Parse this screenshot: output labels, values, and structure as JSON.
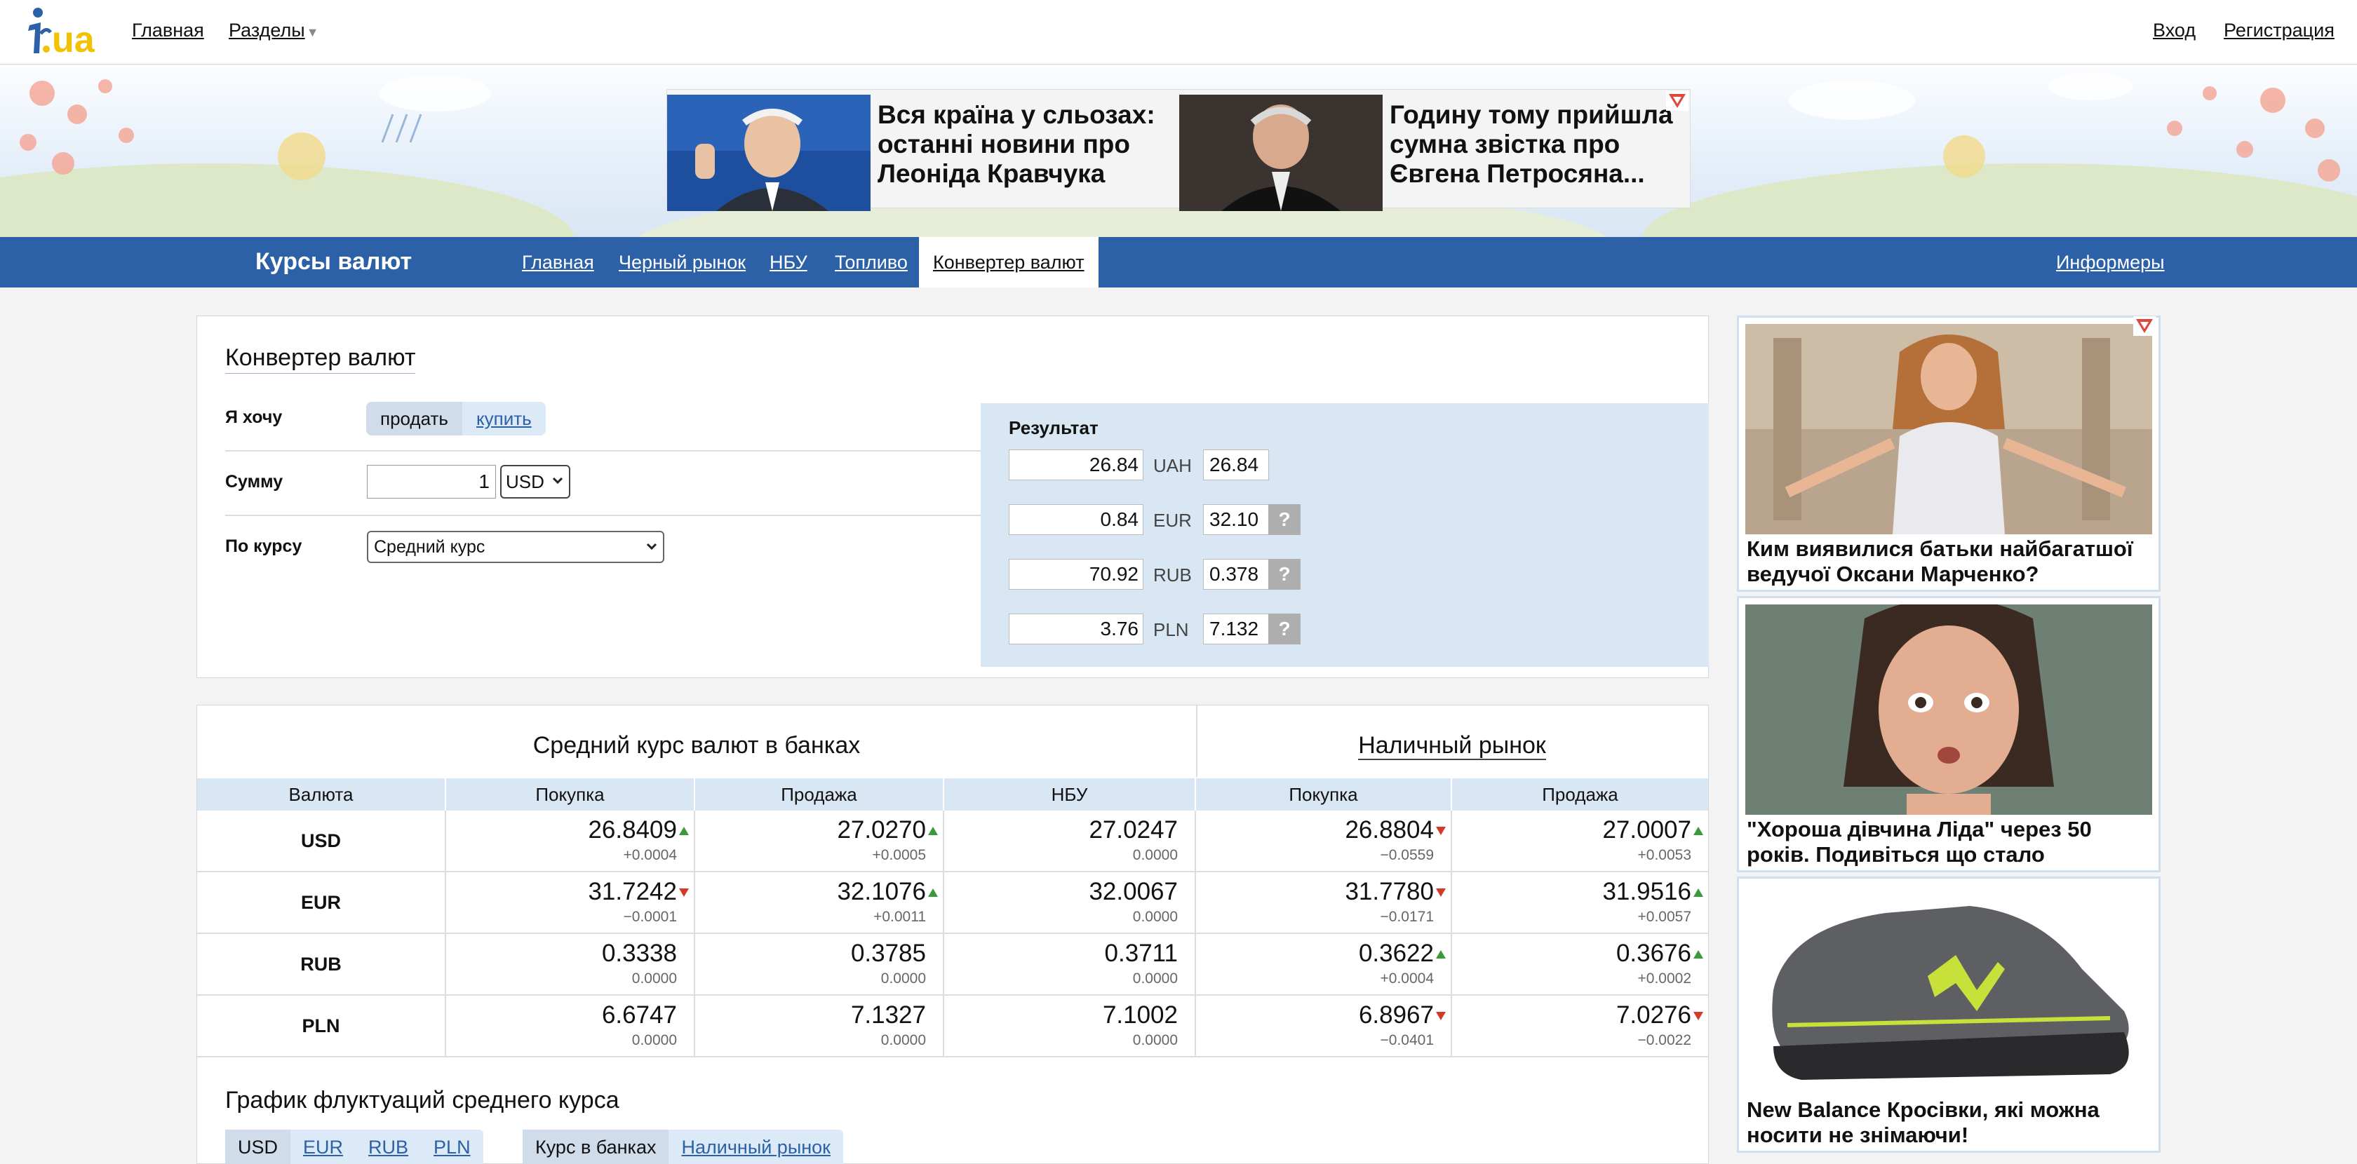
{
  "header": {
    "logo_text": "i.ua",
    "nav_home": "Главная",
    "nav_sections": "Разделы",
    "login": "Вход",
    "register": "Регистрация"
  },
  "promo": {
    "items": [
      {
        "text": "Вся країна у сльозах: останні новини про Леоніда Кравчука"
      },
      {
        "text": "Годину тому прийшла сумна звістка про Євгена Петросяна..."
      }
    ]
  },
  "subnav": {
    "title": "Курсы валют",
    "items": [
      "Главная",
      "Черный рынок",
      "НБУ",
      "Топливо",
      "Конвертер валют"
    ],
    "active": "Конвертер валют",
    "informers": "Информеры"
  },
  "converter": {
    "title": "Конвертер валют",
    "want_label": "Я хочу",
    "sell": "продать",
    "buy": "купить",
    "sum_label": "Сумму",
    "amount": "1",
    "currency": "USD",
    "rate_label": "По курсу",
    "rate_option": "Средний курс",
    "result_title": "Результат",
    "results": [
      {
        "value": "26.84",
        "code": "UAH",
        "rate": "26.84"
      },
      {
        "value": "0.84",
        "code": "EUR",
        "rate": "32.10",
        "help": "?"
      },
      {
        "value": "70.92",
        "code": "RUB",
        "rate": "0.378",
        "help": "?"
      },
      {
        "value": "3.76",
        "code": "PLN",
        "rate": "7.132",
        "help": "?"
      }
    ]
  },
  "rates": {
    "avg_title": "Средний курс валют в банках",
    "cash_title": "Наличный рынок",
    "headers": [
      "Валюта",
      "Покупка",
      "Продажа",
      "НБУ",
      "Покупка",
      "Продажа"
    ],
    "rows": [
      {
        "cur": "USD",
        "cells": [
          {
            "v": "26.8409",
            "d": "+0.0004",
            "t": "up"
          },
          {
            "v": "27.0270",
            "d": "+0.0005",
            "t": "up"
          },
          {
            "v": "27.0247",
            "d": "0.0000",
            "t": ""
          },
          {
            "v": "26.8804",
            "d": "−0.0559",
            "t": "down"
          },
          {
            "v": "27.0007",
            "d": "+0.0053",
            "t": "up"
          }
        ]
      },
      {
        "cur": "EUR",
        "cells": [
          {
            "v": "31.7242",
            "d": "−0.0001",
            "t": "down"
          },
          {
            "v": "32.1076",
            "d": "+0.0011",
            "t": "up"
          },
          {
            "v": "32.0067",
            "d": "0.0000",
            "t": ""
          },
          {
            "v": "31.7780",
            "d": "−0.0171",
            "t": "down"
          },
          {
            "v": "31.9516",
            "d": "+0.0057",
            "t": "up"
          }
        ]
      },
      {
        "cur": "RUB",
        "cells": [
          {
            "v": "0.3338",
            "d": "0.0000",
            "t": ""
          },
          {
            "v": "0.3785",
            "d": "0.0000",
            "t": ""
          },
          {
            "v": "0.3711",
            "d": "0.0000",
            "t": ""
          },
          {
            "v": "0.3622",
            "d": "+0.0004",
            "t": "up"
          },
          {
            "v": "0.3676",
            "d": "+0.0002",
            "t": "up"
          }
        ]
      },
      {
        "cur": "PLN",
        "cells": [
          {
            "v": "6.6747",
            "d": "0.0000",
            "t": ""
          },
          {
            "v": "7.1327",
            "d": "0.0000",
            "t": ""
          },
          {
            "v": "7.1002",
            "d": "0.0000",
            "t": ""
          },
          {
            "v": "6.8967",
            "d": "−0.0401",
            "t": "down"
          },
          {
            "v": "7.0276",
            "d": "−0.0022",
            "t": "down"
          }
        ]
      }
    ]
  },
  "chart_section": {
    "title": "График флуктуаций среднего курса",
    "currency_tabs": [
      "USD",
      "EUR",
      "RUB",
      "PLN"
    ],
    "active_currency": "USD",
    "market_tabs": [
      "Курс в банках",
      "Наличный рынок"
    ],
    "active_market": "Курс в банках"
  },
  "sidebar": {
    "cards": [
      {
        "text": "Ким виявилися батьки найбагатшої ведучої Оксани Марченко?"
      },
      {
        "text": "\"Хороша дівчина Ліда\" через 50 років. Подивіться що стало"
      },
      {
        "text": "New Balance Кросівки, які можна носити не знімаючи!"
      }
    ]
  },
  "colors": {
    "brand_blue": "#2c61a8",
    "up": "#3a9a3a",
    "down": "#d23b2a",
    "result_bg": "#d9e7f4"
  }
}
